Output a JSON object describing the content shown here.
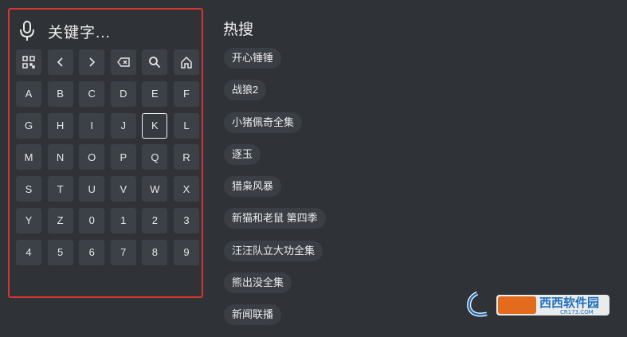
{
  "search": {
    "placeholder": "关键字..."
  },
  "keyboard": {
    "icon_row": [
      {
        "name": "qr-code-icon"
      },
      {
        "name": "chevron-left-icon"
      },
      {
        "name": "chevron-right-icon"
      },
      {
        "name": "backspace-icon"
      },
      {
        "name": "search-icon"
      },
      {
        "name": "home-icon"
      }
    ],
    "rows": [
      [
        "A",
        "B",
        "C",
        "D",
        "E",
        "F"
      ],
      [
        "G",
        "H",
        "I",
        "J",
        "K",
        "L"
      ],
      [
        "M",
        "N",
        "O",
        "P",
        "Q",
        "R"
      ],
      [
        "S",
        "T",
        "U",
        "V",
        "W",
        "X"
      ],
      [
        "Y",
        "Z",
        "0",
        "1",
        "2",
        "3"
      ],
      [
        "4",
        "5",
        "6",
        "7",
        "8",
        "9"
      ]
    ],
    "selected_key": "K"
  },
  "hot": {
    "title": "热搜",
    "items": [
      "开心锤锤",
      "战狼2",
      "小猪佩奇全集",
      "逐玉",
      "猎枭风暴",
      "新猫和老鼠 第四季",
      "汪汪队立大功全集",
      "熊出没全集",
      "新闻联播"
    ]
  },
  "watermark": {
    "brand": "西西软件园",
    "domain": "CR173.COM"
  },
  "colors": {
    "background": "#2f3338",
    "key": "#3c4147",
    "highlight_border": "#d6362f",
    "brand_blue": "#1f6fbf"
  }
}
